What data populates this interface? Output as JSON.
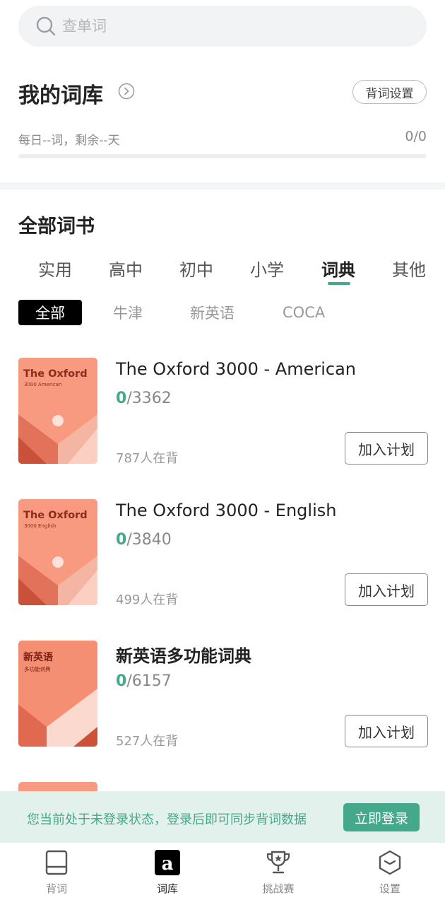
{
  "search": {
    "placeholder": "查单词"
  },
  "library": {
    "title": "我的词库",
    "settings_label": "背词设置",
    "daily_prefix": "每日",
    "daily_dash1": "--",
    "daily_mid": "词，剩余",
    "daily_dash2": "--",
    "daily_suffix": "天",
    "count": "0/0",
    "progress": 0
  },
  "all_books": {
    "title": "全部词书"
  },
  "category_tabs": [
    {
      "label": "实用"
    },
    {
      "label": "高中"
    },
    {
      "label": "初中"
    },
    {
      "label": "小学"
    },
    {
      "label": "词典",
      "active": true
    },
    {
      "label": "其他"
    }
  ],
  "sub_tabs": [
    {
      "label": "全部",
      "active": true
    },
    {
      "label": "牛津"
    },
    {
      "label": "新英语"
    },
    {
      "label": "COCA"
    }
  ],
  "books": [
    {
      "title": "The Oxford 3000 - American",
      "cover_title": "The Oxford",
      "cover_sub": "3000 American",
      "learned": "0",
      "total": "/3362",
      "learners": "787人在背",
      "add_label": "加入计划"
    },
    {
      "title": "The Oxford 3000 - English",
      "cover_title": "The Oxford",
      "cover_sub": "3000 English",
      "learned": "0",
      "total": "/3840",
      "learners": "499人在背",
      "add_label": "加入计划"
    },
    {
      "title": "新英语多功能词典",
      "cover_title": "新英语",
      "cover_sub": "多功能词典",
      "learned": "0",
      "total": "/6157",
      "learners": "527人在背",
      "add_label": "加入计划"
    }
  ],
  "login_banner": {
    "text": "您当前处于未登录状态，登录后即可同步背词数据",
    "button": "立即登录"
  },
  "bottom_nav": [
    {
      "label": "背词",
      "icon": "book-icon"
    },
    {
      "label": "词库",
      "icon": "vocabulary-a-icon",
      "active": true
    },
    {
      "label": "挑战赛",
      "icon": "trophy-icon"
    },
    {
      "label": "设置",
      "icon": "settings-hexagon-icon"
    }
  ],
  "colors": {
    "accent": "#44a88a",
    "cover_light": "#f79a80",
    "cover_dark": "#d6593d",
    "banner_bg": "#e3f1ec"
  }
}
